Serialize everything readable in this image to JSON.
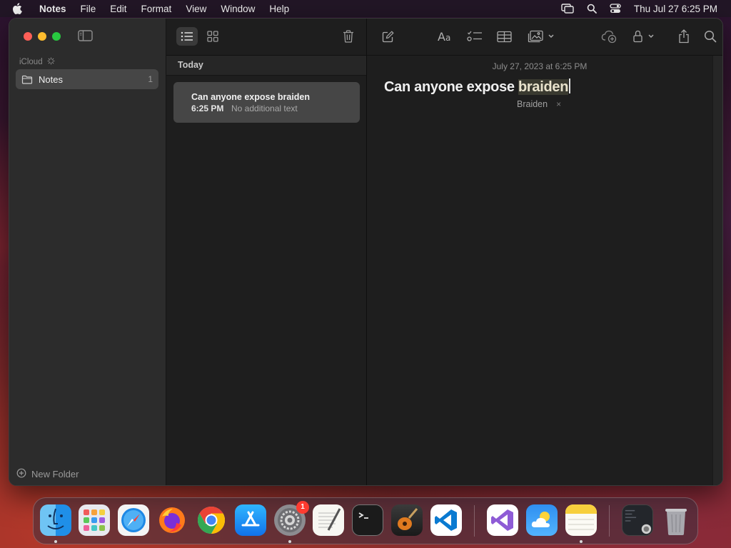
{
  "menubar": {
    "app": "Notes",
    "items": [
      "File",
      "Edit",
      "Format",
      "View",
      "Window",
      "Help"
    ],
    "clock": "Thu Jul 27  6:25 PM",
    "status_icons": [
      "screen-mirroring-icon",
      "spotlight-search-icon",
      "control-center-icon"
    ]
  },
  "sidebar": {
    "section": "iCloud",
    "folders": [
      {
        "name": "Notes",
        "count": "1"
      }
    ],
    "new_folder": "New Folder"
  },
  "list": {
    "group": "Today",
    "notes": [
      {
        "title": "Can anyone expose braiden",
        "time": "6:25 PM",
        "preview": "No additional text"
      }
    ]
  },
  "editor": {
    "date": "July 27, 2023 at 6:25 PM",
    "title_start": "Can anyone expose ",
    "title_marked": "braiden",
    "suggestion": "Braiden",
    "suggestion_close": "×"
  },
  "dock": {
    "apps": [
      "Finder",
      "Launchpad",
      "Safari",
      "Firefox",
      "Google Chrome",
      "App Store",
      "System Settings",
      "TextEdit",
      "Terminal",
      "GarageBand",
      "Visual Studio Code",
      "Visual Studio",
      "Weather",
      "Notes",
      "Screen",
      "Trash"
    ],
    "settings_badge": "1"
  }
}
